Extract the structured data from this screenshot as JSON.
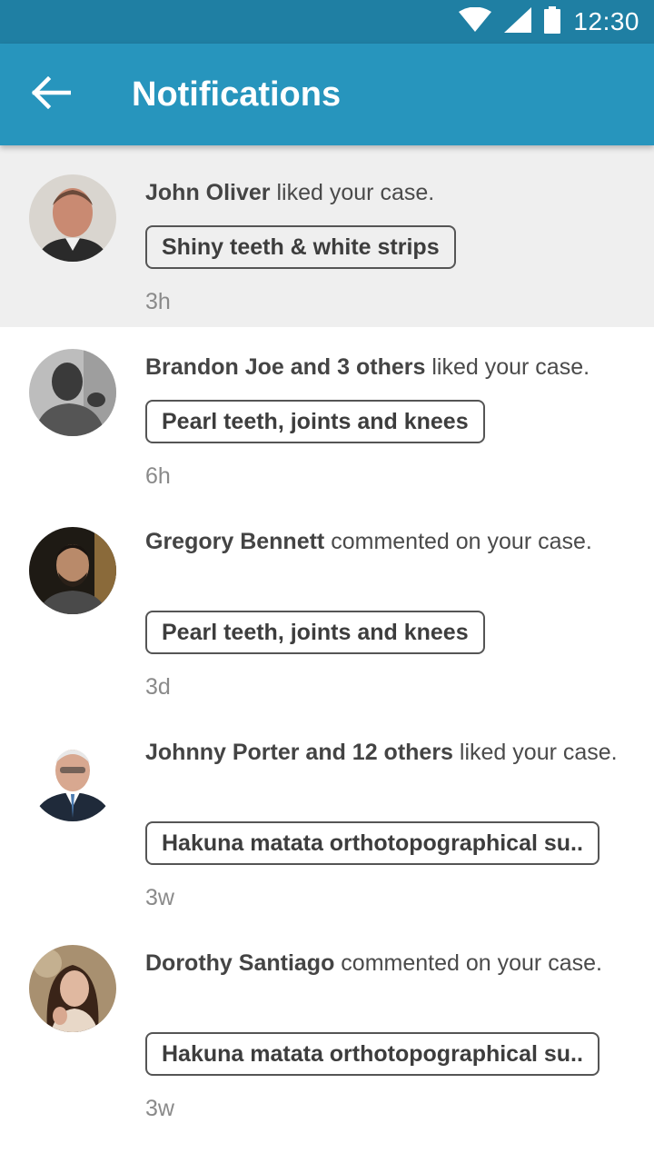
{
  "status_bar": {
    "time": "12:30",
    "icons": [
      "wifi-icon",
      "signal-icon",
      "battery-icon"
    ]
  },
  "app_bar": {
    "title": "Notifications",
    "back_icon": "arrow-back-icon"
  },
  "colors": {
    "status_bar": "#1f7fa3",
    "app_bar": "#2795bd",
    "highlight_row": "#efefef"
  },
  "notifications": [
    {
      "actor": "John Oliver",
      "action": "liked your case.",
      "case": "Shiny teeth & white strips",
      "time": "3h",
      "unread": true
    },
    {
      "actor": "Brandon Joe and 3 others",
      "action": "liked your case.",
      "case": "Pearl teeth, joints and knees",
      "time": "6h",
      "unread": false
    },
    {
      "actor": "Gregory Bennett",
      "action": "commented on your case.",
      "case": "Pearl teeth, joints and knees",
      "time": "3d",
      "unread": false
    },
    {
      "actor": "Johnny Porter and 12 others",
      "action": "liked your case.",
      "case": "Hakuna matata orthotopographical su..",
      "time": "3w",
      "unread": false
    },
    {
      "actor": "Dorothy Santiago",
      "action": "commented on your case.",
      "case": "Hakuna matata orthotopographical su..",
      "time": "3w",
      "unread": false
    }
  ]
}
